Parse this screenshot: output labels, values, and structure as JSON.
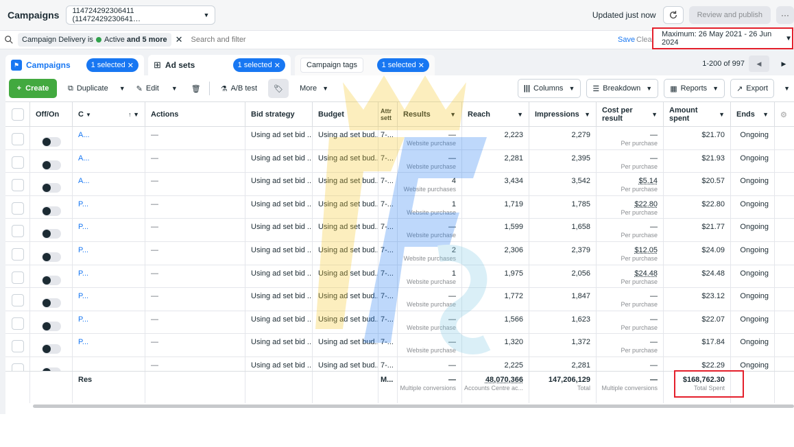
{
  "topbar": {
    "title": "Campaigns",
    "account": "114724292306411 (11472429230641…",
    "updated": "Updated just now",
    "review_label": "Review and publish",
    "more_label": "···"
  },
  "filterbar": {
    "chip_prefix": "Campaign Delivery is",
    "chip_active": "Active",
    "chip_more": "and 5 more",
    "search_placeholder": "Search and filter",
    "save_label": "Save",
    "clear_label": "Clear",
    "date_range": "Maximum: 26 May 2021 - 26 Jun 2024"
  },
  "tabs": {
    "campaigns": {
      "label": "Campaigns",
      "selected": "1 selected"
    },
    "adsets": {
      "label": "Ad sets",
      "selected": "1 selected"
    },
    "tags": {
      "label": "Campaign tags",
      "selected": "1 selected"
    }
  },
  "pager": {
    "range": "1-200 of 997"
  },
  "toolbar": {
    "create": "Create",
    "duplicate": "Duplicate",
    "edit": "Edit",
    "abtest": "A/B test",
    "more": "More",
    "columns": "Columns",
    "breakdown": "Breakdown",
    "reports": "Reports",
    "export": "Export"
  },
  "columns": [
    "Off/On",
    "C",
    "Actions",
    "Bid strategy",
    "Budget",
    "Attr sett",
    "Results",
    "Reach",
    "Impressions",
    "Cost per result",
    "Amount spent",
    "Ends"
  ],
  "rows": [
    {
      "name": "A...",
      "actions": "—",
      "bid": "Using ad set bid ...",
      "budget": "Using ad set bud...",
      "attr": "7-...",
      "result_main": "—",
      "result_sub": "Website purchase",
      "reach": "2,223",
      "impressions": "2,279",
      "cpr_main": "—",
      "cpr_sub": "Per purchase",
      "spent": "$21.70",
      "ends": "Ongoing"
    },
    {
      "name": "A...",
      "actions": "—",
      "bid": "Using ad set bid ...",
      "budget": "Using ad set bud...",
      "attr": "7-...",
      "result_main": "—",
      "result_sub": "Website purchase",
      "reach": "2,281",
      "impressions": "2,395",
      "cpr_main": "—",
      "cpr_sub": "Per purchase",
      "spent": "$21.93",
      "ends": "Ongoing"
    },
    {
      "name": "A...",
      "actions": "—",
      "bid": "Using ad set bid ...",
      "budget": "Using ad set bud...",
      "attr": "7-...",
      "result_main": "4",
      "result_sub": "Website purchases",
      "reach": "3,434",
      "impressions": "3,542",
      "cpr_main": "$5.14",
      "cpr_sub": "Per purchase",
      "spent": "$20.57",
      "ends": "Ongoing"
    },
    {
      "name": "P...",
      "actions": "—",
      "bid": "Using ad set bid ...",
      "budget": "Using ad set bud...",
      "attr": "7-...",
      "result_main": "1",
      "result_sub": "Website purchase",
      "reach": "1,719",
      "impressions": "1,785",
      "cpr_main": "$22.80",
      "cpr_sub": "Per purchase",
      "spent": "$22.80",
      "ends": "Ongoing"
    },
    {
      "name": "P...",
      "actions": "—",
      "bid": "Using ad set bid ...",
      "budget": "Using ad set bud...",
      "attr": "7-...",
      "result_main": "—",
      "result_sub": "Website purchase",
      "reach": "1,599",
      "impressions": "1,658",
      "cpr_main": "—",
      "cpr_sub": "Per purchase",
      "spent": "$21.77",
      "ends": "Ongoing"
    },
    {
      "name": "P...",
      "actions": "—",
      "bid": "Using ad set bid ...",
      "budget": "Using ad set bud...",
      "attr": "7-...",
      "result_main": "2",
      "result_sub": "Website purchases",
      "reach": "2,306",
      "impressions": "2,379",
      "cpr_main": "$12.05",
      "cpr_sub": "Per purchase",
      "spent": "$24.09",
      "ends": "Ongoing"
    },
    {
      "name": "P...",
      "actions": "—",
      "bid": "Using ad set bid ...",
      "budget": "Using ad set bud...",
      "attr": "7-...",
      "result_main": "1",
      "result_sub": "Website purchase",
      "reach": "1,975",
      "impressions": "2,056",
      "cpr_main": "$24.48",
      "cpr_sub": "Per purchase",
      "spent": "$24.48",
      "ends": "Ongoing"
    },
    {
      "name": "P...",
      "actions": "—",
      "bid": "Using ad set bid ...",
      "budget": "Using ad set bud...",
      "attr": "7-...",
      "result_main": "—",
      "result_sub": "Website purchase",
      "reach": "1,772",
      "impressions": "1,847",
      "cpr_main": "—",
      "cpr_sub": "Per purchase",
      "spent": "$23.12",
      "ends": "Ongoing"
    },
    {
      "name": "P...",
      "actions": "—",
      "bid": "Using ad set bid ...",
      "budget": "Using ad set bud...",
      "attr": "7-...",
      "result_main": "—",
      "result_sub": "Website purchase",
      "reach": "1,566",
      "impressions": "1,623",
      "cpr_main": "—",
      "cpr_sub": "Per purchase",
      "spent": "$22.07",
      "ends": "Ongoing"
    },
    {
      "name": "P...",
      "actions": "—",
      "bid": "Using ad set bid ...",
      "budget": "Using ad set bud...",
      "attr": "7-...",
      "result_main": "—",
      "result_sub": "Website purchase",
      "reach": "1,320",
      "impressions": "1,372",
      "cpr_main": "—",
      "cpr_sub": "Per purchase",
      "spent": "$17.84",
      "ends": "Ongoing"
    },
    {
      "name": "",
      "actions": "—",
      "bid": "Using ad set bid ...",
      "budget": "Using ad set bud...",
      "attr": "7-...",
      "result_main": "—",
      "result_sub": "",
      "reach": "2,225",
      "impressions": "2,281",
      "cpr_main": "—",
      "cpr_sub": "",
      "spent": "$22.29",
      "ends": "Ongoing"
    }
  ],
  "totals": {
    "name": "Res",
    "attr": "M...",
    "results_main": "—",
    "results_sub": "Multiple conversions",
    "reach_main": "48,070,366",
    "reach_sub": "Accounts Centre ac...",
    "impressions_main": "147,206,129",
    "impressions_sub": "Total",
    "cpr_main": "—",
    "cpr_sub": "Multiple conversions",
    "spent_main": "$168,762.30",
    "spent_sub": "Total Spent"
  },
  "colors": {
    "accent": "#1877f2",
    "create": "#42a93f",
    "highlight": "#e41e2a"
  }
}
